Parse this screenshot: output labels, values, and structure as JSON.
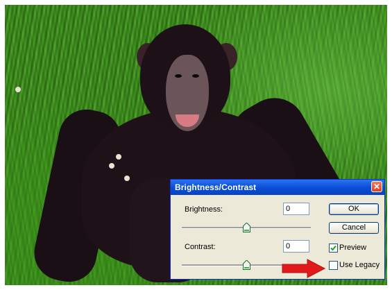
{
  "dialog": {
    "title": "Brightness/Contrast",
    "close_glyph": "✕",
    "brightness": {
      "label": "Brightness:",
      "value": "0",
      "slider_fraction": 0.5
    },
    "contrast": {
      "label": "Contrast:",
      "value": "0",
      "slider_fraction": 0.5
    },
    "buttons": {
      "ok": "OK",
      "cancel": "Cancel"
    },
    "preview": {
      "label": "Preview",
      "checked": true
    },
    "use_legacy": {
      "label": "Use Legacy",
      "checked": false
    }
  },
  "colors": {
    "titlebar": "#0a4fd6",
    "dialog_bg": "#ece9d8",
    "close_button": "#d7402b",
    "arrow": "#e11b1b"
  },
  "icons": [
    "close-icon",
    "slider-thumb-icon",
    "checkmark-icon",
    "red-arrow-icon"
  ]
}
